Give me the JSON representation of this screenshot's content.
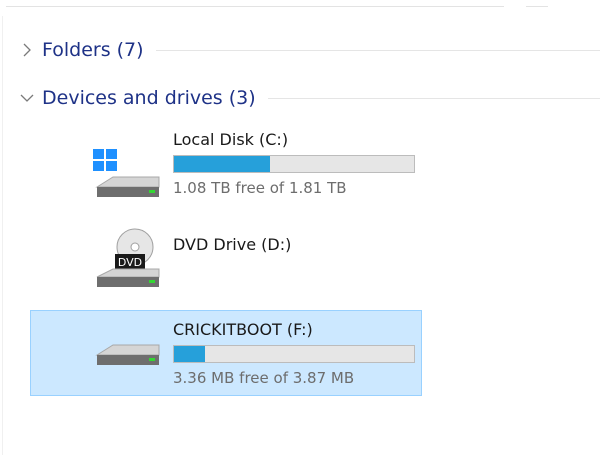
{
  "groups": {
    "folders": {
      "title": "Folders",
      "count": "(7)",
      "expanded": false
    },
    "devices": {
      "title": "Devices and drives",
      "count": "(3)",
      "expanded": true
    }
  },
  "drives": [
    {
      "name": "Local Disk (C:)",
      "free_text": "1.08 TB free of 1.81 TB",
      "used_fraction": 0.4,
      "icon": "windows-hard-drive-icon",
      "selected": false
    },
    {
      "name": "DVD Drive (D:)",
      "icon": "dvd-drive-icon",
      "badge": "DVD",
      "selected": false
    },
    {
      "name": "CRICKITBOOT (F:)",
      "free_text": "3.36 MB free of 3.87 MB",
      "used_fraction": 0.13,
      "icon": "removable-drive-icon",
      "selected": true
    }
  ],
  "colors": {
    "header_text": "#1e3287",
    "bar_fill": "#26a0da",
    "selection_bg": "#cce8ff",
    "selection_border": "#99d1ff"
  }
}
